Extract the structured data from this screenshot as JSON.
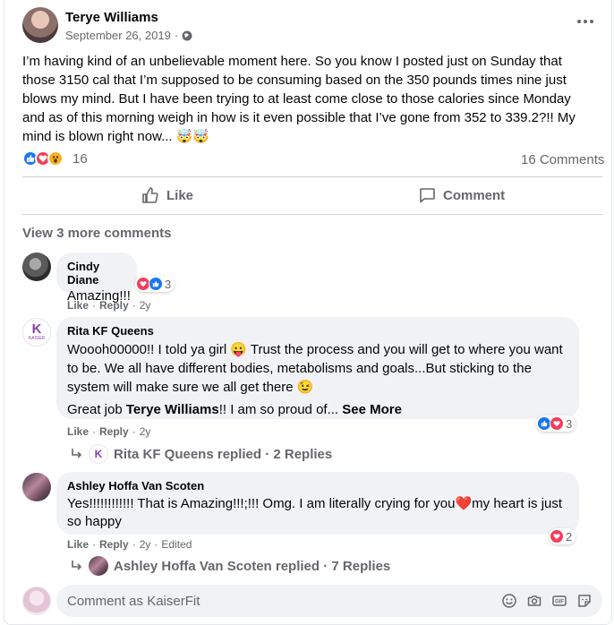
{
  "post": {
    "author": "Terye Williams",
    "date": "September 26, 2019",
    "privacy_dot": "·",
    "text": "I’m having kind of an unbelievable moment here. So you know I posted just on Sunday that those 3150 cal that I’m supposed to be consuming based on the 350 pounds times nine just blows my mind. But I have been trying to at least come close to those calories since Monday and as of this morning weigh in how is it even possible that I’ve gone from 352 to 339.2?!! My mind is blown right now... 🤯🤯",
    "reaction_count": "16",
    "comments_count": "16 Comments",
    "more_icon": "more-dots-icon"
  },
  "actions": {
    "like": "Like",
    "comment": "Comment"
  },
  "view_more": "View 3 more comments",
  "comments": [
    {
      "name": "Cindy Diane",
      "text": "Amazing!!!",
      "like": "Like",
      "reply": "Reply",
      "time": "2y",
      "reactions": "3"
    },
    {
      "name": "Rita KF Queens",
      "text1": "Woooh00000!! I told ya girl 😛 Trust the process and you will get to where you want to be. We all have different bodies, metabolisms and goals...But sticking to the system will make sure we all get there 😉",
      "text2_pre": "Great job ",
      "text2_name": "Terye Williams",
      "text2_post": "!! I am so proud of... ",
      "see_more": "See More",
      "like": "Like",
      "reply": "Reply",
      "time": "2y",
      "reactions": "3",
      "replied": "Rita KF Queens replied · 2 Replies",
      "avatar_text": "KAISER"
    },
    {
      "name": "Ashley Hoffa Van Scoten",
      "text": "Yes!!!!!!!!!!!! That is Amazing!!!;!!! Omg. I am literally crying for you❤️my heart is just so happy",
      "like": "Like",
      "reply": "Reply",
      "time": "2y",
      "edited": "Edited",
      "reactions": "2",
      "replied": "Ashley Hoffa Van Scoten replied · 7 Replies"
    }
  ],
  "composer": {
    "placeholder": "Comment as KaiserFit"
  },
  "colors": {
    "like": "#1877f2",
    "love": "#f33e58",
    "wow": "#f7b125",
    "text_secondary": "#65676b"
  }
}
